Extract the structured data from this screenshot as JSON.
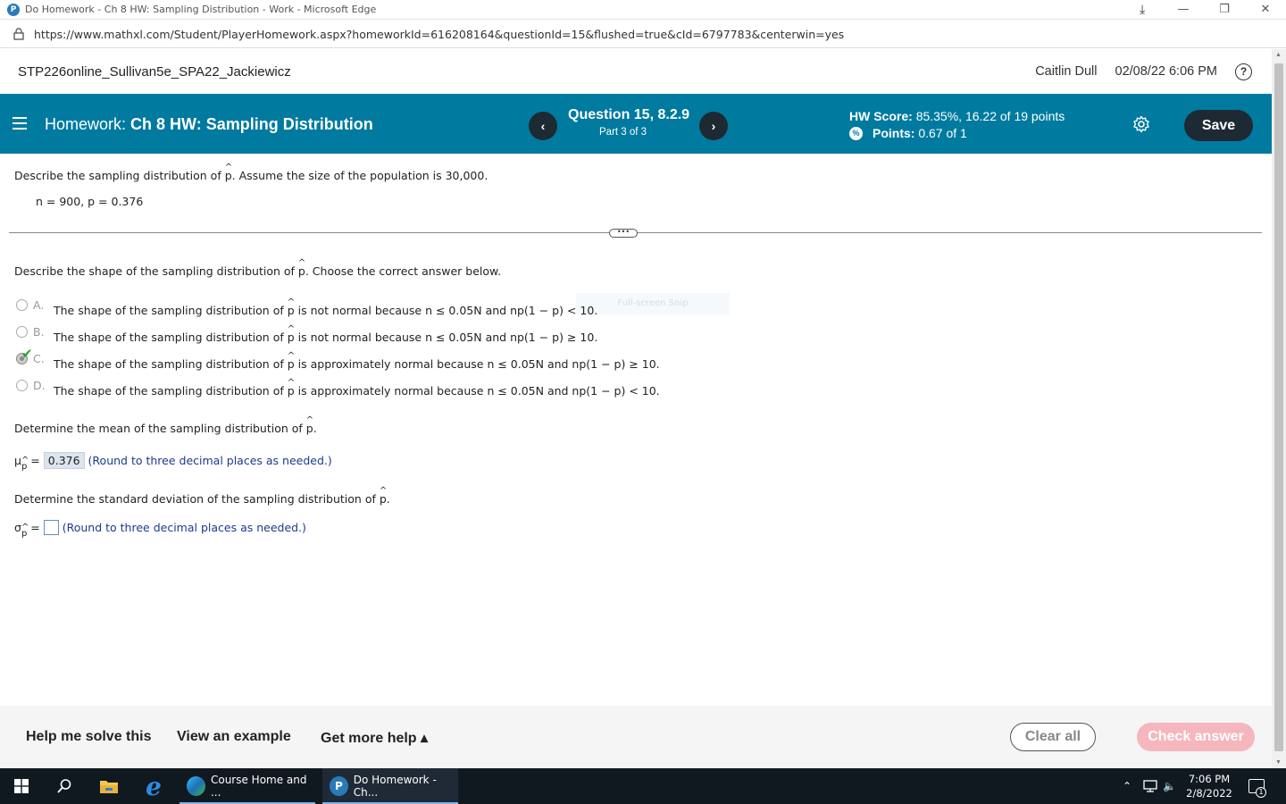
{
  "window": {
    "title": "Do Homework - Ch 8 HW: Sampling Distribution - Work - Microsoft Edge",
    "url": "https://www.mathxl.com/Student/PlayerHomework.aspx?homeworkId=616208164&questionId=15&flushed=true&cId=6797783&centerwin=yes"
  },
  "course_header": {
    "course": "STP226online_Sullivan5e_SPA22_Jackiewicz",
    "user": "Caitlin Dull",
    "datetime": "02/08/22 6:06 PM",
    "help": "?"
  },
  "hw_bar": {
    "label": "Homework:",
    "name": "Ch 8 HW: Sampling Distribution",
    "question": "Question 15, 8.2.9",
    "part": "Part 3 of 3",
    "score_label": "HW Score:",
    "score_value": "85.35%, 16.22 of 19 points",
    "points_label": "Points:",
    "points_value": "0.67 of 1",
    "save_label": "Save",
    "prev": "‹",
    "next": "›"
  },
  "question": {
    "intro_before": "Describe the sampling distribution of",
    "intro_p": "p",
    "intro_after": ". Assume the size of the population is 30,000.",
    "given": "n = 900, p = 0.376",
    "divider_handle": "•••",
    "shape_before": "Describe the shape of the sampling distribution of",
    "shape_p": "p",
    "shape_after": ". Choose the correct answer below.",
    "ghost_text": "Full-screen Snip",
    "options": [
      {
        "letter": "A.",
        "before": "The shape of the sampling distribution of",
        "p": "p",
        "after": "is not normal because n ≤ 0.05N and np(1 − p) < 10.",
        "selected": false
      },
      {
        "letter": "B.",
        "before": "The shape of the sampling distribution of",
        "p": "p",
        "after": "is not normal because n ≤ 0.05N and np(1 − p) ≥ 10.",
        "selected": false
      },
      {
        "letter": "C.",
        "before": "The shape of the sampling distribution of",
        "p": "p",
        "after": "is approximately normal because n ≤ 0.05N and np(1 − p) ≥ 10.",
        "selected": true
      },
      {
        "letter": "D.",
        "before": "The shape of the sampling distribution of",
        "p": "p",
        "after": "is approximately normal because n ≤ 0.05N and np(1 − p) < 10.",
        "selected": false
      }
    ],
    "mean_before": "Determine the mean of the sampling distribution of",
    "mean_p": "p",
    "mean_after": ".",
    "mean_symbol": "μ",
    "mean_sub": "p",
    "mean_eq": "=",
    "mean_value": "0.376",
    "mean_hint": "(Round to three decimal places as needed.)",
    "sd_before": "Determine the standard deviation of the sampling distribution of",
    "sd_p": "p",
    "sd_after": ".",
    "sd_symbol": "σ",
    "sd_sub": "p",
    "sd_eq": "=",
    "sd_value": "",
    "sd_hint": "(Round to three decimal places as needed.)"
  },
  "bottom_bar": {
    "help_solve": "Help me solve this",
    "view_example": "View an example",
    "more_help": "Get more help ▴",
    "clear_all": "Clear all",
    "check_answer": "Check answer"
  },
  "taskbar": {
    "apps": [
      {
        "label": "Course Home and ..."
      },
      {
        "label": "Do Homework - Ch..."
      }
    ],
    "time": "7:06 PM",
    "date": "2/8/2022",
    "notif_count": "1"
  },
  "colors": {
    "hw_bar": "#007a9f",
    "dark_button": "#1e2a33",
    "check_answer": "#f6b6bd",
    "hint_text": "#1a3b8c",
    "taskbar": "#101820"
  }
}
